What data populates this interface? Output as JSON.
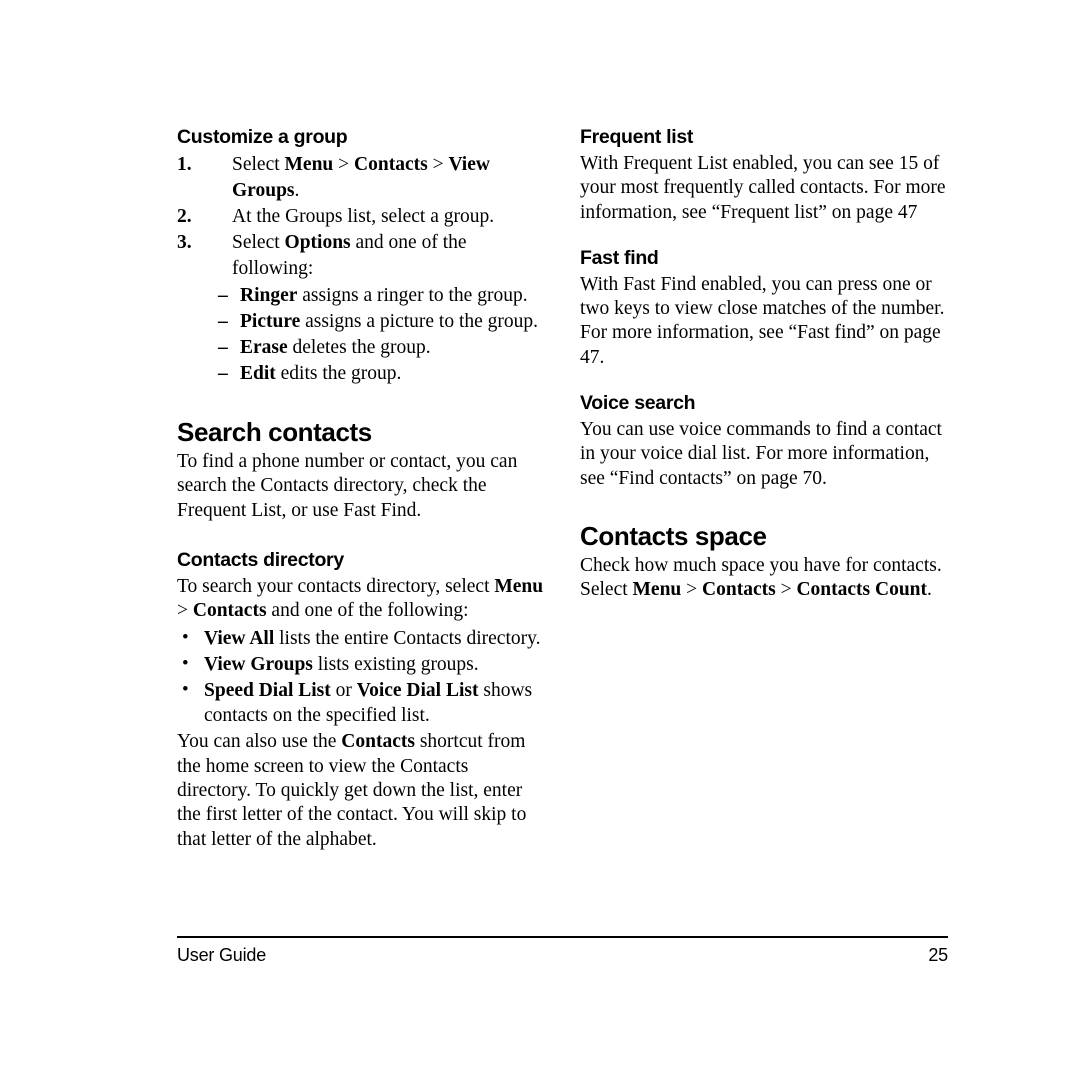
{
  "page": {
    "footer_left": "User Guide",
    "page_number": "25"
  },
  "left_column": {
    "customize_group": {
      "heading": "Customize a group",
      "steps": [
        {
          "num": "1.",
          "pre": "Select ",
          "b1": "Menu",
          "sep1": " > ",
          "b2": "Contacts",
          "sep2": " > ",
          "b3": "View Groups",
          "post": "."
        },
        {
          "num": "2.",
          "text": "At the Groups list, select a group."
        },
        {
          "num": "3.",
          "pre": "Select ",
          "bold": "Options",
          "post": " and one of the following:"
        }
      ],
      "options": [
        {
          "dash": "–",
          "bold": "Ringer",
          "rest": " assigns a ringer to the group."
        },
        {
          "dash": "–",
          "bold": "Picture",
          "rest": " assigns a picture to the group."
        },
        {
          "dash": "–",
          "bold": "Erase",
          "rest": " deletes the group."
        },
        {
          "dash": "–",
          "bold": "Edit",
          "rest": " edits the group."
        }
      ]
    },
    "search_contacts": {
      "heading": "Search contacts",
      "intro": "To find a phone number or contact, you can search the Contacts directory, check the Frequent List, or use Fast Find."
    },
    "contacts_directory": {
      "heading": "Contacts directory",
      "intro_pre": "To search your contacts directory, select ",
      "intro_b1": "Menu",
      "intro_sep": " > ",
      "intro_b2": "Contacts",
      "intro_post": " and one of the following:",
      "bullets": [
        {
          "marker": "•",
          "bold": "View All",
          "rest": " lists the entire Contacts directory."
        },
        {
          "marker": "•",
          "bold": "View Groups",
          "rest": " lists existing groups."
        },
        {
          "marker": "•",
          "boldA": "Speed Dial List",
          "mid": " or ",
          "boldB": "Voice Dial List",
          "rest": " shows contacts on the specified list."
        }
      ],
      "outro_pre": "You can also use the ",
      "outro_bold": "Contacts",
      "outro_post": " shortcut from the home screen to view the Contacts directory. To quickly get down the list, enter the first letter of the contact. You will skip to that letter of the alphabet."
    }
  },
  "right_column": {
    "frequent_list": {
      "heading": "Frequent list",
      "body": "With Frequent List enabled, you can see 15 of your most frequently called contacts. For more information, see “Frequent list” on page 47"
    },
    "fast_find": {
      "heading": "Fast find",
      "body": "With Fast Find enabled, you can press one or two keys to view close matches of the number. For more information, see “Fast find” on page 47."
    },
    "voice_search": {
      "heading": "Voice search",
      "body": "You can use voice commands to find a contact in your voice dial list. For more information, see “Find contacts” on page 70."
    },
    "contacts_space": {
      "heading": "Contacts space",
      "body": "Check how much space you have for contacts.",
      "select_pre": "Select ",
      "select_b1": "Menu",
      "select_sep1": " > ",
      "select_b2": "Contacts",
      "select_sep2": " > ",
      "select_b3": "Contacts Count",
      "select_post": "."
    }
  }
}
